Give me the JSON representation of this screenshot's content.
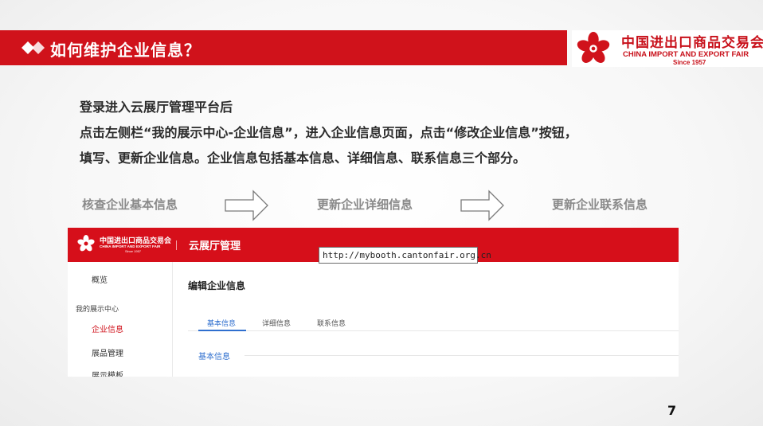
{
  "slide": {
    "title": "如何维护企业信息？",
    "page_number": "7",
    "accent_color": "#d0121b"
  },
  "brand": {
    "name_cn": "中国进出口商品交易会",
    "name_en": "CHINA IMPORT AND EXPORT FAIR",
    "since": "Since 1957",
    "logo_icon": "canton-fair-flower-icon"
  },
  "intro": {
    "line1": "登录进入云展厅管理平台后",
    "line2": "点击左侧栏“我的展示中心-企业信息”，进入企业信息页面，点击“修改企业信息”按钮，",
    "line3": "填写、更新企业信息。企业信息包括基本信息、详细信息、联系信息三个部分。"
  },
  "steps": [
    {
      "label": "核查企业基本信息"
    },
    {
      "label": "更新企业详细信息"
    },
    {
      "label": "更新企业联系信息"
    }
  ],
  "screenshot": {
    "brand_cn": "中国进出口商品交易会",
    "brand_en": "CHINA IMPORT AND EXPORT FAIR",
    "brand_since": "Since 1957",
    "app_name": "云展厅管理",
    "url": "http://mybooth.cantonfair.org.cn",
    "sidebar": {
      "overview": "概览",
      "group": "我的展示中心",
      "company_info": "企业信息",
      "products": "展品管理",
      "template": "展示模板"
    },
    "main_title": "编辑企业信息",
    "tabs": [
      "基本信息",
      "详细信息",
      "联系信息"
    ],
    "active_tab": "基本信息",
    "section_label": "基本信息"
  }
}
